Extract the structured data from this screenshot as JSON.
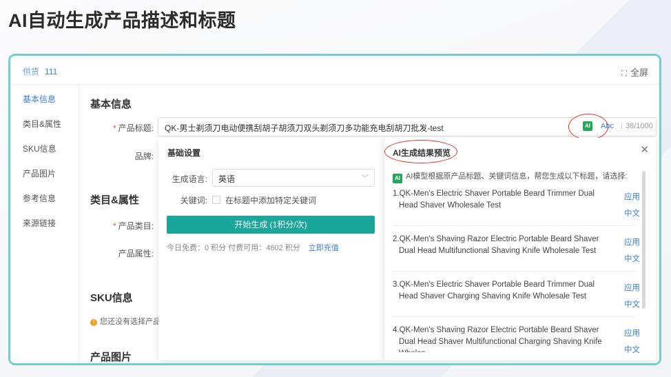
{
  "headline": "AI自动生成产品描述和标题",
  "topbar": {
    "tab_pill": "供货",
    "tab_value": "111",
    "fullscreen_icon": "⛶",
    "fullscreen_label": "全屏"
  },
  "leftnav": {
    "items": [
      {
        "label": "基本信息"
      },
      {
        "label": "类目&属性"
      },
      {
        "label": "SKU信息"
      },
      {
        "label": "产品图片"
      },
      {
        "label": "参考信息"
      },
      {
        "label": "来源链接"
      }
    ]
  },
  "main": {
    "section_basic": "基本信息",
    "title_label": "产品标题:",
    "title_required": "*",
    "title_value": "QK-男士剃须刀电动便携刮胡子胡须刀双头剃须刀多功能充电刮胡刀批发-test",
    "ai_badge": "AI",
    "abc": "Abc",
    "counter": "38/1000",
    "brand_label": "品牌:",
    "section_category": "类目&属性",
    "category_label": "产品类目:",
    "attr_label": "产品属性:",
    "section_sku": "SKU信息",
    "sku_warning": "您还没有选择产品",
    "section_images": "产品图片"
  },
  "settings": {
    "title": "基础设置",
    "lang_label": "生成语言:",
    "lang_value": "英语",
    "keyword_label": "关键词:",
    "keyword_checkbox": "在标题中添加特定关键词",
    "generate_button": "开始生成 (1积分/次)",
    "quota": "今日免费：0 积分  付费可用：4602 积分",
    "recharge": "立即充值"
  },
  "results": {
    "title": "AI生成结果预览",
    "intro_badge": "AI",
    "intro": "AI模型根据原产品标题、关键词信息，帮您生成以下标题，请选择:",
    "apply_label": "应用",
    "cn_label": "中文",
    "items": [
      {
        "text": "1.QK-Men's Electric Shaver Portable Beard Trimmer Dual Head Shaver Wholesale Test"
      },
      {
        "text": "2.QK-Men's Shaving Razor Electric Portable Beard Shaver Dual Head Multifunctional Shaving Knife Wholesale Test"
      },
      {
        "text": "3.QK-Men's Electric Shaver Portable Beard Trimmer Dual Head Shaver Charging Shaving Knife Wholesale Test"
      },
      {
        "text": "4.QK-Men's Shaving Razor Electric Portable Beard Shaver Dual Head Shaver Multifunctional Charging Shaving Knife Wholes"
      }
    ]
  }
}
